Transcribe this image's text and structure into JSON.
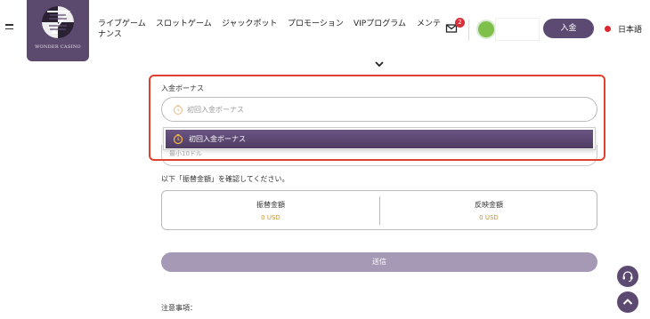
{
  "header": {
    "logo_text": "WONDER CASINO",
    "nav": [
      {
        "label": "ライブゲーム"
      },
      {
        "label": "スロットゲーム"
      },
      {
        "label": "ジャックポット"
      },
      {
        "label": "プロモーション"
      },
      {
        "label": "VIPプログラム"
      },
      {
        "label": "メンテ"
      },
      {
        "label": "ナンス"
      }
    ],
    "mail_badge": "2",
    "deposit_label": "入金",
    "language": "日本語"
  },
  "form": {
    "bonus_label": "入金ボーナス",
    "bonus_placeholder": "初回入金ボーナス",
    "dropdown_option": "初回入金ボーナス",
    "amount_placeholder": "最小10ドル",
    "confirm_text": "以下「振替金額」を確認してください。",
    "summary": {
      "transfer_label": "振替金額",
      "transfer_value": "0 USD",
      "reflect_label": "反映金額",
      "reflect_value": "0 USD"
    },
    "submit_label": "送信",
    "notes_label": "注意事項："
  },
  "colors": {
    "brand": "#5c4a72",
    "submit_disabled": "#a699b6",
    "highlight": "#e0402e",
    "value": "#c9963a",
    "badge": "#d6303a"
  },
  "icons": [
    "menu-icon",
    "mail-icon",
    "chevron-down-icon",
    "clock-icon",
    "support-icon",
    "chevron-up-icon"
  ]
}
